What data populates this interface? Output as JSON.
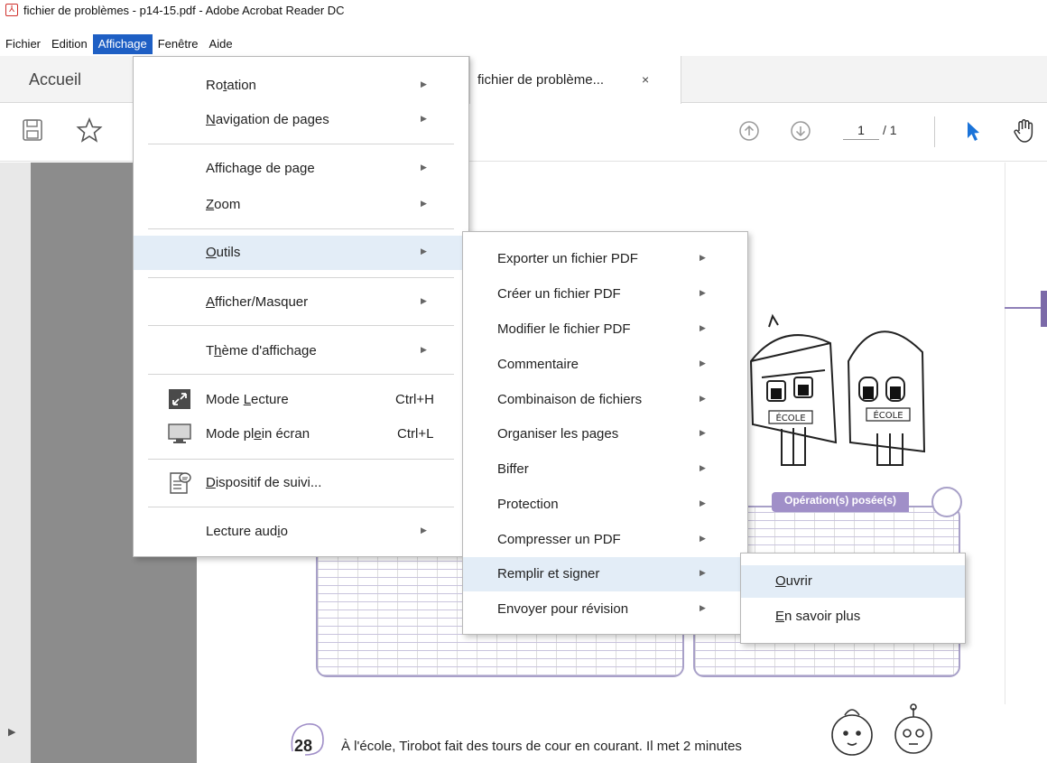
{
  "window": {
    "title": "fichier de problèmes - p14-15.pdf - Adobe Acrobat Reader DC"
  },
  "menubar": {
    "items": [
      "Fichier",
      "Edition",
      "Affichage",
      "Fenêtre",
      "Aide"
    ],
    "active": "Affichage"
  },
  "tabs": {
    "home": "Accueil",
    "document": "fichier de problème...",
    "close": "×"
  },
  "toolbar": {
    "page_current": "1",
    "page_total": "/ 1",
    "icons": [
      "save-icon",
      "star-icon",
      "page-up-icon",
      "page-down-icon",
      "select-cursor-icon",
      "hand-tool-icon"
    ]
  },
  "affichage_menu": {
    "items": [
      {
        "pre": "Ro",
        "ul": "t",
        "post": "ation",
        "submenu": true
      },
      {
        "pre": "",
        "ul": "N",
        "post": "avigation de pages",
        "submenu": true
      },
      {
        "pre": "Affichage de page",
        "ul": "",
        "post": "",
        "submenu": true
      },
      {
        "pre": "",
        "ul": "Z",
        "post": "oom",
        "submenu": true
      },
      {
        "pre": "",
        "ul": "O",
        "post": "utils",
        "submenu": true
      },
      {
        "pre": "",
        "ul": "A",
        "post": "fficher/Masquer",
        "submenu": true
      },
      {
        "pre": "T",
        "ul": "h",
        "post": "ème d'affichage",
        "submenu": true
      },
      {
        "pre": "Mode ",
        "ul": "L",
        "post": "ecture",
        "shortcut": "Ctrl+H"
      },
      {
        "pre": "Mode pl",
        "ul": "e",
        "post": "in écran",
        "shortcut": "Ctrl+L"
      },
      {
        "pre": "",
        "ul": "D",
        "post": "ispositif de suivi...",
        "submenu": false
      },
      {
        "pre": "Lecture aud",
        "ul": "i",
        "post": "o",
        "submenu": true
      }
    ]
  },
  "outils_menu": {
    "items": [
      "Exporter un fichier PDF",
      "Créer un fichier PDF",
      "Modifier le fichier PDF",
      "Commentaire",
      "Combinaison de fichiers",
      "Organiser les pages",
      "Biffer",
      "Protection",
      "Compresser un PDF",
      "Remplir et signer",
      "Envoyer pour révision"
    ],
    "highlighted": "Remplir et signer"
  },
  "remplir_menu": {
    "items": [
      {
        "ul": "O",
        "post": "uvrir"
      },
      {
        "ul": "E",
        "post": "n savoir plus"
      }
    ],
    "highlighted": "Ouvrir"
  },
  "document": {
    "operation_label": "Opération(s) posée(s)",
    "problem_number": "28",
    "problem_text": "À l'école, Tirobot fait des tours de cour en courant. Il met 2 minutes",
    "school_sign": "ÉCOLE"
  }
}
